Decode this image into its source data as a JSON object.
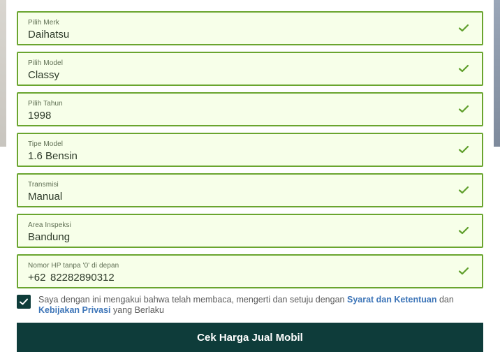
{
  "form": {
    "fields": [
      {
        "label": "Pilih Merk",
        "value": "Daihatsu"
      },
      {
        "label": "Pilih Model",
        "value": "Classy"
      },
      {
        "label": "Pilih Tahun",
        "value": "1998"
      },
      {
        "label": "Tipe Model",
        "value": "1.6 Bensin"
      },
      {
        "label": "Transmisi",
        "value": "Manual"
      },
      {
        "label": "Area Inspeksi",
        "value": "Bandung"
      }
    ],
    "phone": {
      "label": "Nomor HP tanpa '0' di depan",
      "prefix": "+62",
      "value": "82282890312"
    },
    "agreement": {
      "checked": true,
      "text_1": "Saya dengan ini mengakui bahwa telah membaca, mengerti dan setuju dengan",
      "link_terms": "Syarat dan Ketentuan",
      "text_2": "dan",
      "link_privacy": "Kebijakan Privasi",
      "text_3": "yang Berlaku"
    },
    "submit_label": "Cek Harga Jual Mobil"
  },
  "colors": {
    "field_bg": "#f7ffe9",
    "field_border": "#6aa52f",
    "check_green": "#5e9e2a",
    "button_bg": "#0e3c3a",
    "link": "#3d75b8"
  },
  "icons": [
    "check-icon",
    "checkbox-checked-icon"
  ]
}
